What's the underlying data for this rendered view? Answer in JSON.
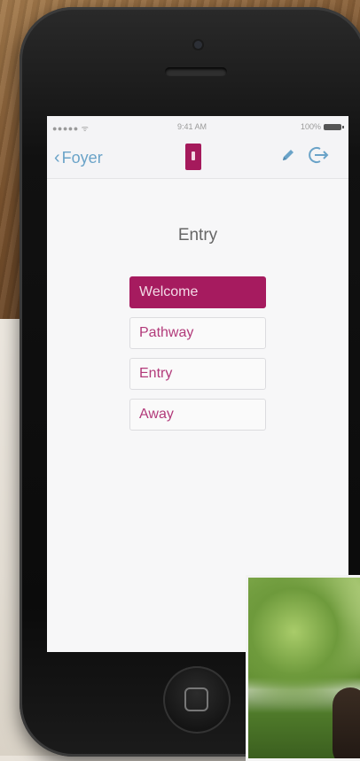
{
  "status_bar": {
    "carrier": "●●●●● ᯤ",
    "time": "9:41 AM",
    "battery": "100%"
  },
  "nav": {
    "back_label": "Foyer",
    "edit_icon": "pencil-icon",
    "exit_icon": "sign-out-icon",
    "device_icon": "light-switch-icon"
  },
  "page": {
    "title": "Entry"
  },
  "scenes": [
    {
      "label": "Welcome",
      "active": true
    },
    {
      "label": "Pathway",
      "active": false
    },
    {
      "label": "Entry",
      "active": false
    },
    {
      "label": "Away",
      "active": false
    }
  ],
  "colors": {
    "accent": "#a61b5f",
    "link": "#6aa3c8"
  }
}
